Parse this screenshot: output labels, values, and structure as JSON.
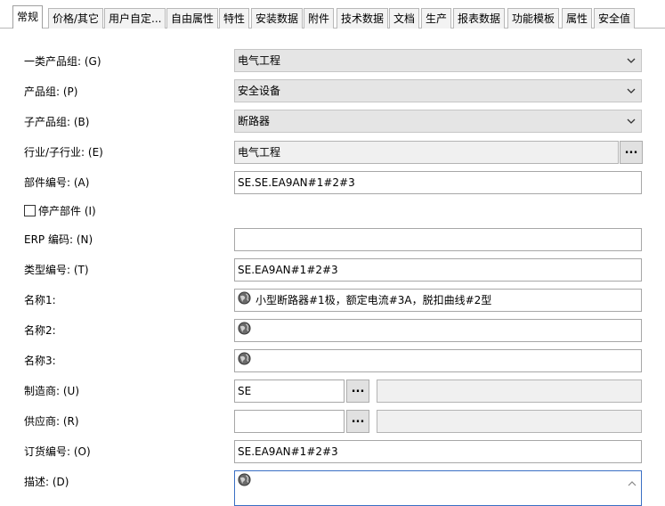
{
  "tabs": [
    {
      "label": "常规",
      "active": true
    },
    {
      "label": "价格/其它"
    },
    {
      "label": "用户自定..."
    },
    {
      "label": "自由属性"
    },
    {
      "label": "特性"
    },
    {
      "label": "安装数据"
    },
    {
      "label": "附件"
    },
    {
      "label": "技术数据"
    },
    {
      "label": "文档"
    },
    {
      "label": "生产"
    },
    {
      "label": "报表数据"
    },
    {
      "label": "功能模板"
    },
    {
      "label": "属性"
    },
    {
      "label": "安全值"
    }
  ],
  "form": {
    "product_group_1": {
      "label": "一类产品组: (G)",
      "value": "电气工程"
    },
    "product_group": {
      "label": "产品组: (P)",
      "value": "安全设备"
    },
    "sub_product_group": {
      "label": "子产品组: (B)",
      "value": "断路器"
    },
    "industry": {
      "label": "行业/子行业: (E)",
      "value": "电气工程",
      "browse": "..."
    },
    "part_number": {
      "label": "部件编号: (A)",
      "value": "SE.SE.EA9AN#1#2#3"
    },
    "discontinued": {
      "label": "停产部件 (I)",
      "checked": false
    },
    "erp_code": {
      "label": "ERP 编码: (N)",
      "value": ""
    },
    "type_number": {
      "label": "类型编号: (T)",
      "value": "SE.EA9AN#1#2#3"
    },
    "name1": {
      "label": "名称1:",
      "value": "小型断路器#1极，额定电流#3A，脱扣曲线#2型"
    },
    "name2": {
      "label": "名称2:",
      "value": ""
    },
    "name3": {
      "label": "名称3:",
      "value": ""
    },
    "manufacturer": {
      "label": "制造商: (U)",
      "value": "SE",
      "browse": "...",
      "name": ""
    },
    "supplier": {
      "label": "供应商: (R)",
      "value": "",
      "browse": "...",
      "name": ""
    },
    "order_number": {
      "label": "订货编号: (O)",
      "value": "SE.EA9AN#1#2#3"
    },
    "description": {
      "label": "描述: (D)",
      "value": ""
    }
  },
  "icons": {
    "dropdown": "chevron-down-icon",
    "language": "globe-icon",
    "scroll": "chevron-up-icon"
  }
}
